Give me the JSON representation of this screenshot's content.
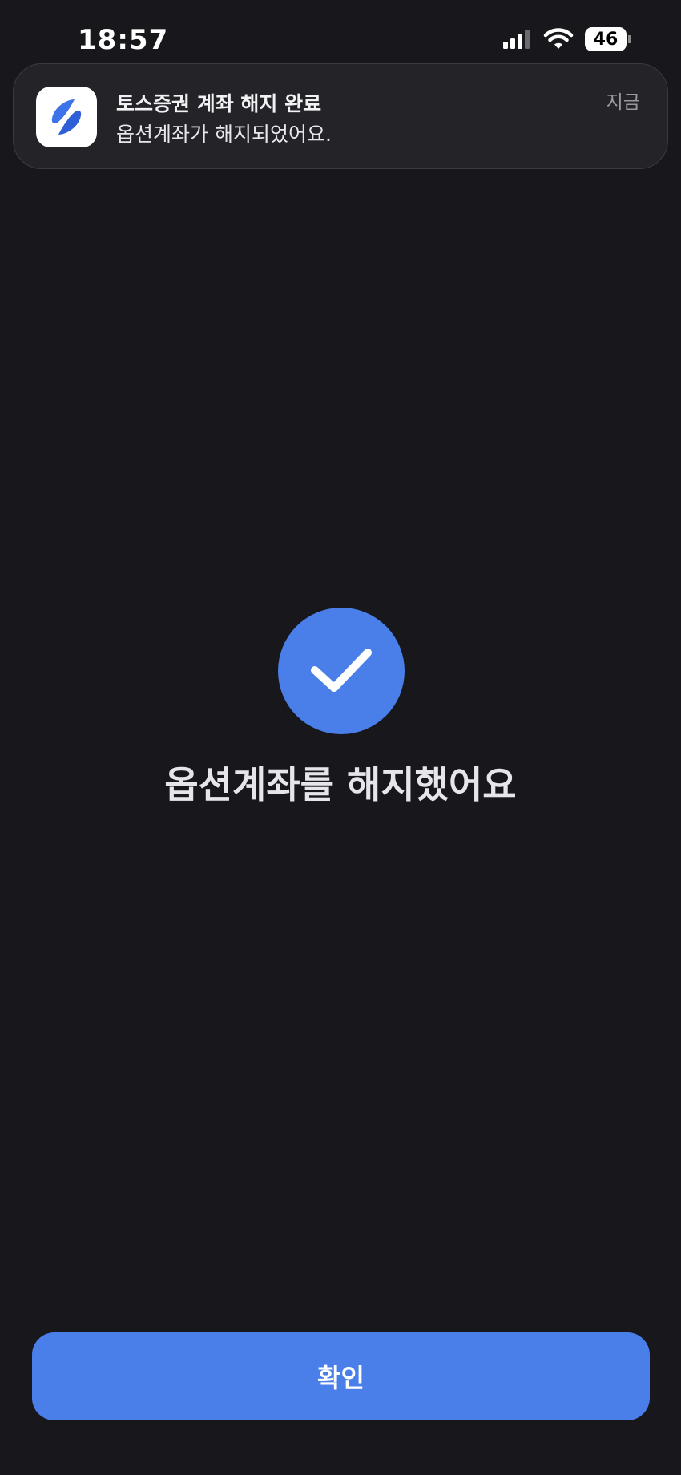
{
  "status_bar": {
    "time": "18:57",
    "battery": "46",
    "icons": [
      "signal-icon",
      "wifi-icon",
      "battery-icon"
    ]
  },
  "notification": {
    "app_icon": "toss-securities-app-icon",
    "title": "토스증권 계좌 해지 완료",
    "body": "옵션계좌가 해지되었어요.",
    "time": "지금"
  },
  "main": {
    "icon": "check-circle-icon",
    "message": "옵션계좌를 해지했어요"
  },
  "footer": {
    "confirm_label": "확인"
  },
  "colors": {
    "background": "#18181c",
    "accent": "#4a7fea",
    "notification_bg": "#232328"
  }
}
